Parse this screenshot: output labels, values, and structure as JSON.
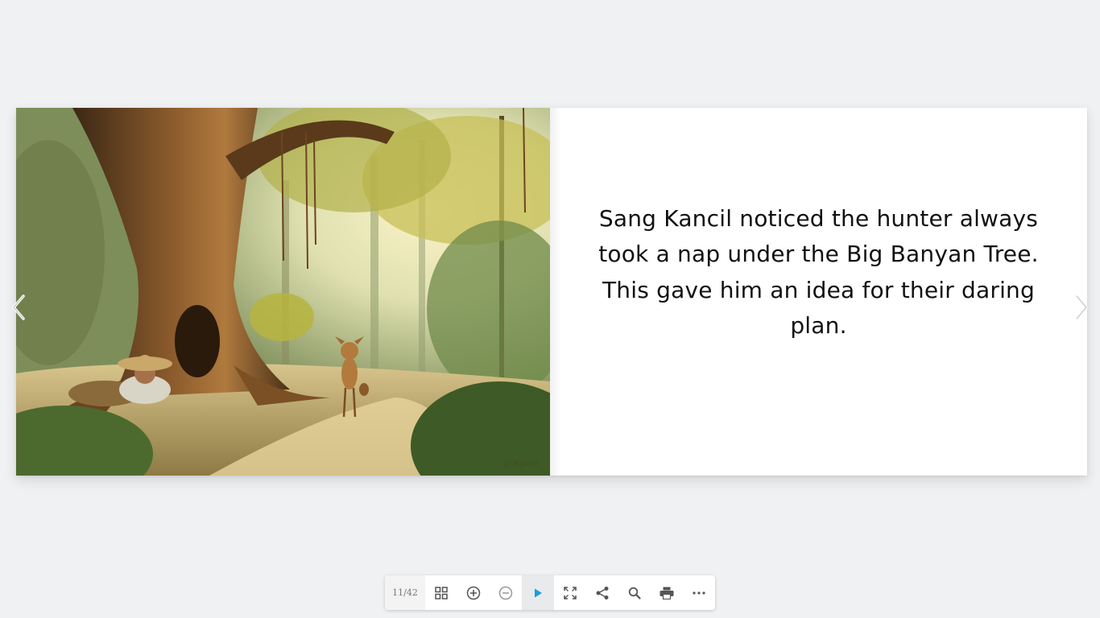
{
  "story": {
    "text": "Sang Kancil noticed the hunter always took a nap under the Big Banyan Tree. This gave him an idea for their daring plan."
  },
  "navigation": {
    "prev_icon": "chevron-left-icon",
    "next_icon": "chevron-right-icon"
  },
  "toolbar": {
    "page_indicator": "11/42",
    "buttons": [
      {
        "name": "thumbnails",
        "icon": "grid-icon"
      },
      {
        "name": "zoom-in",
        "icon": "zoom-in-icon"
      },
      {
        "name": "zoom-out",
        "icon": "zoom-out-icon"
      },
      {
        "name": "autoplay",
        "icon": "play-icon"
      },
      {
        "name": "fullscreen",
        "icon": "fullscreen-icon"
      },
      {
        "name": "share",
        "icon": "share-icon"
      },
      {
        "name": "search",
        "icon": "search-icon"
      },
      {
        "name": "print",
        "icon": "print-icon"
      },
      {
        "name": "more",
        "icon": "more-icon"
      }
    ]
  },
  "colors": {
    "background": "#f0f1f3",
    "page": "#ffffff",
    "text": "#111111",
    "play_accent": "#1a9fd8",
    "icon": "#555555"
  }
}
